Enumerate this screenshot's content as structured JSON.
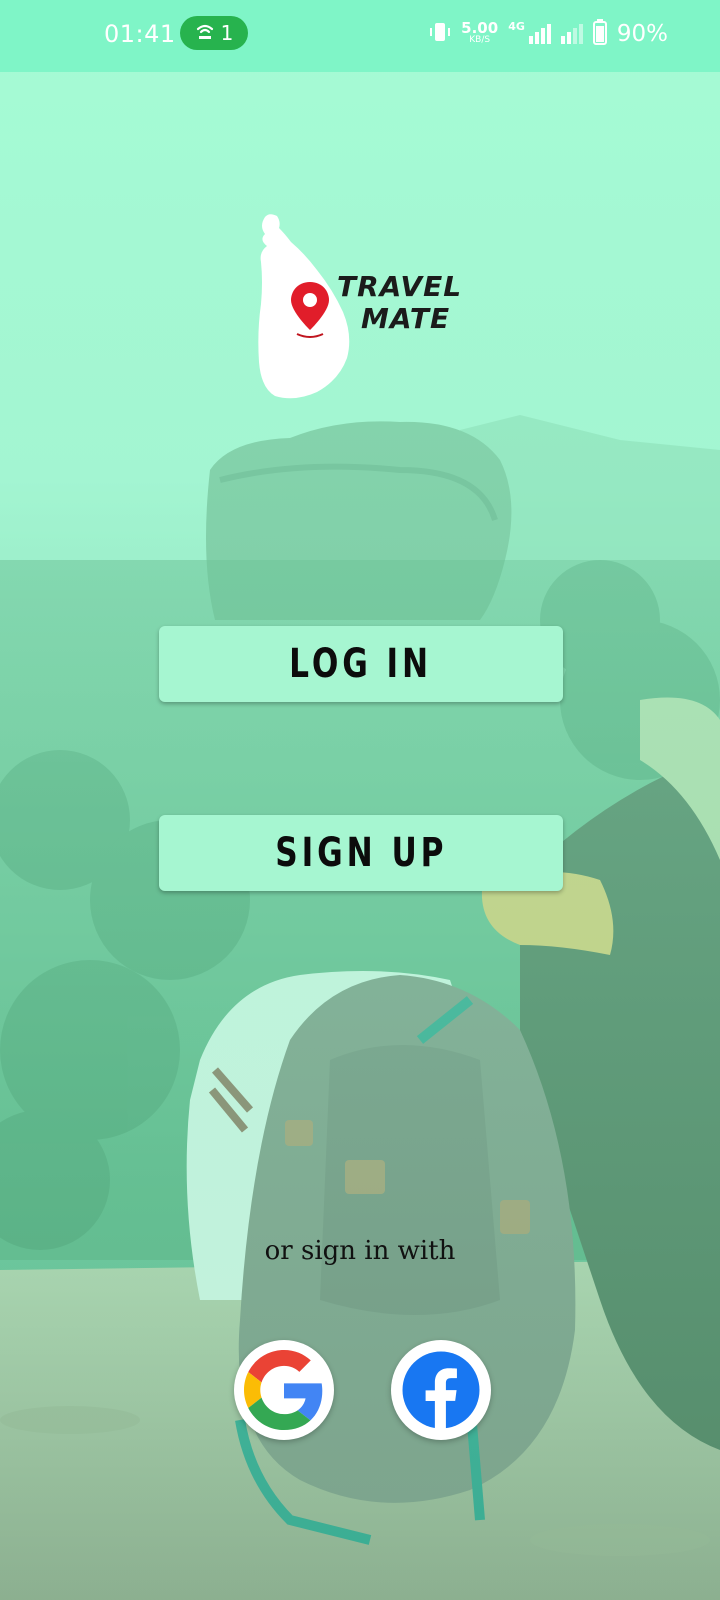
{
  "status_bar": {
    "time": "01:41",
    "hotspot_count": "1",
    "speed_value": "5.00",
    "speed_unit": "KB/S",
    "network_type": "4G",
    "battery": "90%"
  },
  "brand": {
    "line1": "TRAVEL",
    "line2": "MATE"
  },
  "buttons": {
    "login": "LOG IN",
    "signup": "SIGN UP"
  },
  "social": {
    "prompt": "or sign in with",
    "google": "google-icon",
    "facebook": "facebook-icon"
  },
  "colors": {
    "status_bar": "#7ff5c7",
    "button_bg": "#a6f6d1",
    "overlay": "#7ff5c7",
    "pin_red": "#e11d2a",
    "facebook_blue": "#1877f2"
  }
}
